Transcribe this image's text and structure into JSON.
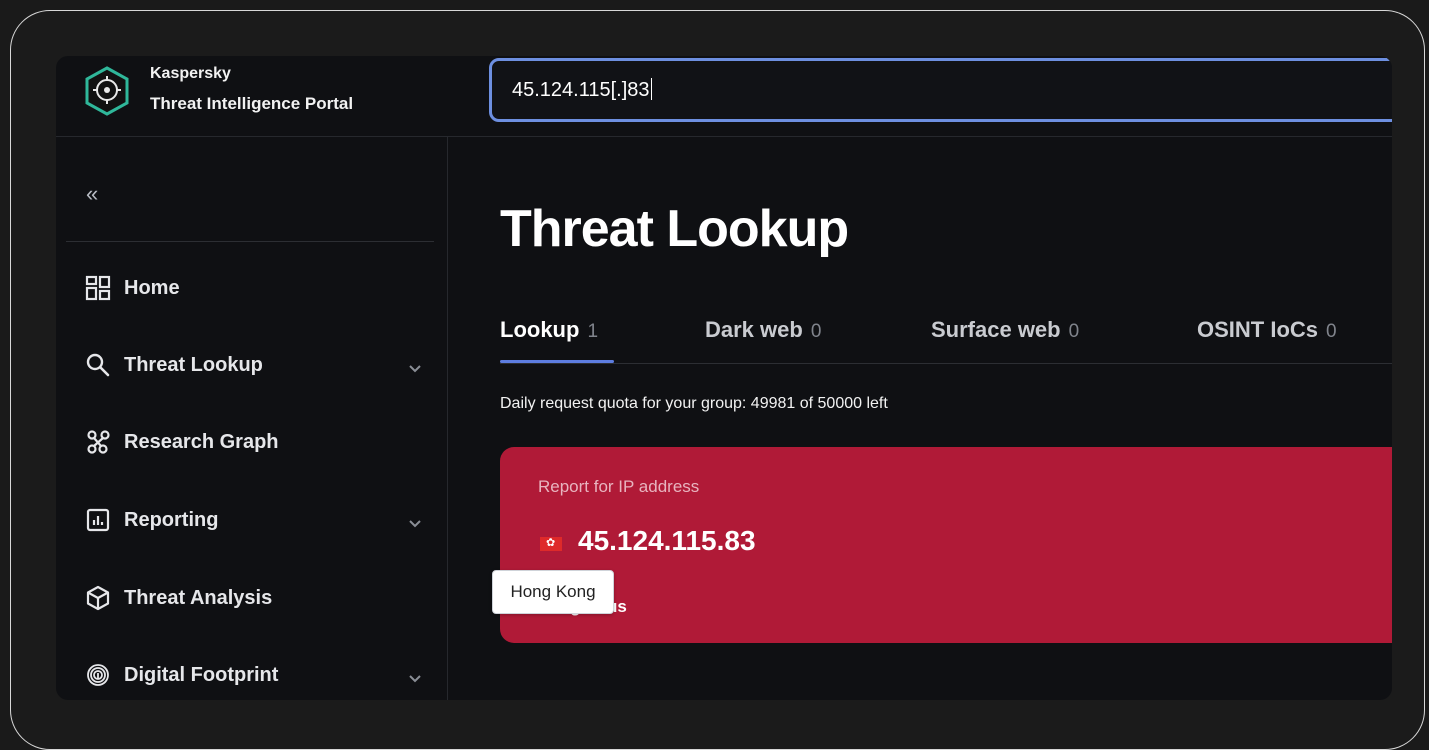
{
  "brand": {
    "name": "Kaspersky",
    "product": "Threat Intelligence Portal"
  },
  "search": {
    "value": "45.124.115[.]83"
  },
  "sidebar": {
    "collapse_label": "«",
    "items": [
      {
        "label": "Home",
        "icon": "dashboard-icon",
        "has_chevron": false
      },
      {
        "label": "Threat Lookup",
        "icon": "search-icon",
        "has_chevron": true
      },
      {
        "label": "Research Graph",
        "icon": "graph-icon",
        "has_chevron": false
      },
      {
        "label": "Reporting",
        "icon": "report-icon",
        "has_chevron": true
      },
      {
        "label": "Threat Analysis",
        "icon": "cube-icon",
        "has_chevron": false
      },
      {
        "label": "Digital Footprint",
        "icon": "fingerprint-icon",
        "has_chevron": true
      }
    ]
  },
  "main": {
    "title": "Threat Lookup",
    "tabs": [
      {
        "label": "Lookup",
        "count": "1",
        "active": true
      },
      {
        "label": "Dark web",
        "count": "0",
        "active": false
      },
      {
        "label": "Surface web",
        "count": "0",
        "active": false
      },
      {
        "label": "OSINT IoCs",
        "count": "0",
        "active": false
      }
    ],
    "quota": "Daily request quota for your group: 49981 of 50000 left",
    "report": {
      "label": "Report for IP address",
      "ip": "45.124.115.83",
      "status": "Dangerous",
      "status_visible": "gerous",
      "flag": "Hong Kong flag",
      "color": "#b01a37"
    },
    "tooltip": "Hong Kong"
  }
}
